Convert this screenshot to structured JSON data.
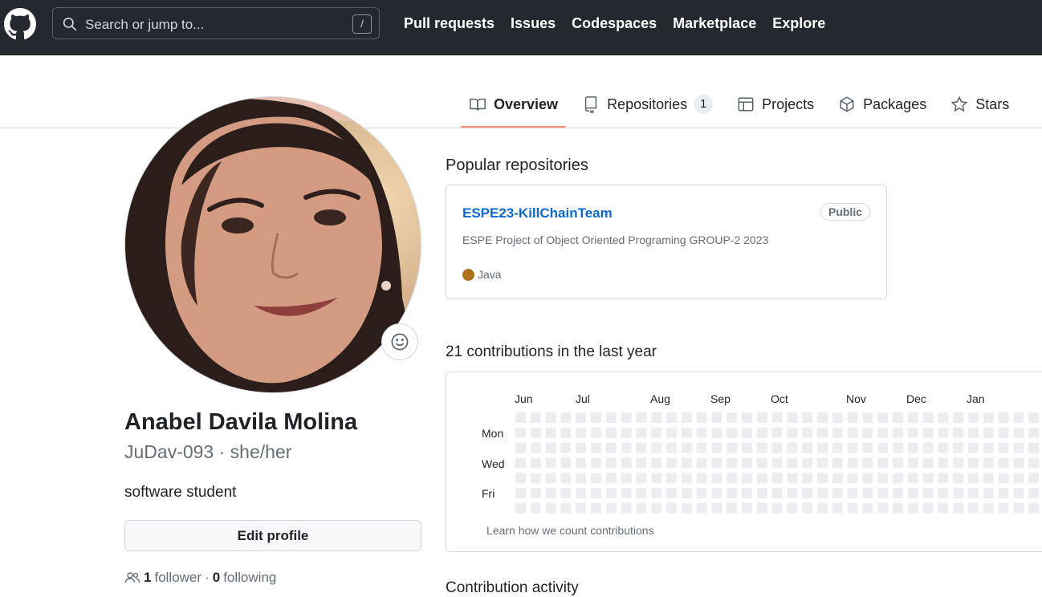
{
  "header": {
    "logo_icon": "github-octocat-icon",
    "search_placeholder": "Search or jump to...",
    "search_shortcut": "/",
    "nav": [
      "Pull requests",
      "Issues",
      "Codespaces",
      "Marketplace",
      "Explore"
    ]
  },
  "tabs": [
    {
      "label": "Overview",
      "icon": "book-icon",
      "selected": true
    },
    {
      "label": "Repositories",
      "icon": "repo-icon",
      "count": "1"
    },
    {
      "label": "Projects",
      "icon": "table-icon"
    },
    {
      "label": "Packages",
      "icon": "package-icon"
    },
    {
      "label": "Stars",
      "icon": "star-icon"
    }
  ],
  "profile": {
    "name": "Anabel Davila Molina",
    "username": "JuDav-093 · she/her",
    "bio": "software student",
    "edit_label": "Edit profile",
    "followers_count": "1",
    "followers_label": "follower",
    "separator": "·",
    "following_count": "0",
    "following_label": "following"
  },
  "popular": {
    "title": "Popular repositories",
    "repos": [
      {
        "name": "ESPE23-KillChainTeam",
        "visibility": "Public",
        "description": "ESPE Project of Object Oriented Programing GROUP-2 2023",
        "language": "Java",
        "language_color": "#b07219"
      }
    ]
  },
  "contributions": {
    "title": "21 contributions in the last year",
    "months": [
      "Jun",
      "Jul",
      "Aug",
      "Sep",
      "Oct",
      "Nov",
      "Dec",
      "Jan"
    ],
    "days": [
      "Mon",
      "Wed",
      "Fri"
    ],
    "learn_link": "Learn how we count contributions",
    "empty_color": "#ebedf0"
  },
  "activity": {
    "title": "Contribution activity"
  }
}
